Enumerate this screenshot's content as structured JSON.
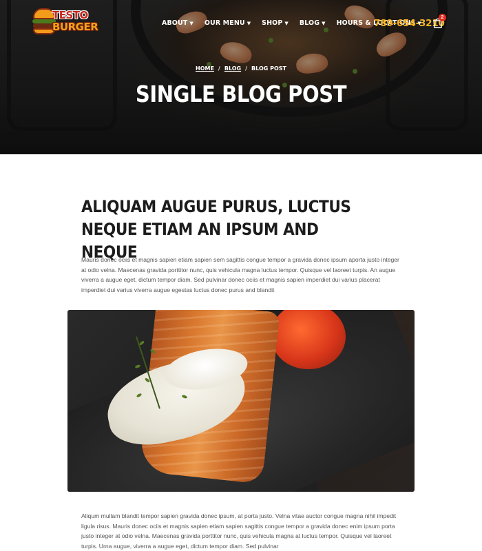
{
  "brand": {
    "line1": "TESTO",
    "line2": "BURGER"
  },
  "nav": [
    {
      "label": "ABOUT"
    },
    {
      "label": "OUR MENU"
    },
    {
      "label": "SHOP"
    },
    {
      "label": "BLOG"
    },
    {
      "label": "HOURS & LOCATIONS"
    }
  ],
  "phone": "789-654-3210",
  "cart": {
    "count": "2"
  },
  "breadcrumb": {
    "home": "HOME",
    "blog": "BLOG",
    "current": "BLOG POST",
    "separator": "/"
  },
  "hero": {
    "title": "SINGLE BLOG POST"
  },
  "post": {
    "title": "ALIQUAM AUGUE PURUS, LUCTUS NEQUE ETIAM AN IPSUM AND NEQUE",
    "paragraph1": "Mauris donec ociis et magnis sapien etiam sapien sem sagittis congue tempor a gravida donec ipsum aporta justo integer at odio velna. Maecenas gravida porttitor nunc, quis vehicula magna luctus tempor. Quisque vel laoreet turpis. An augue viverra a augue eget, dictum tempor diam. Sed pulvinar donec ociis et magnis sapien imperdiet dui varius placerat imperdiet dui varius viverra augue egestas luctus donec purus and blandit",
    "paragraph2": "Aliqum mullam blandit tempor sapien gravida donec ipsum, at porta justo. Velna vitae auctor congue magna nihil impedit ligula risus. Mauris donec ociis et magnis sapien etiam sapien sagittis congue tempor a gravida donec enim ipsum porta justo integer at odio velna. Maecenas gravida porttitor nunc, quis vehicula magna at luctus tempor. Quisque vel laoreet turpis. Urna augue, viverra a augue eget, dictum tempor diam. Sed pulvinar"
  },
  "icons": {
    "nav_chevron": "chevron-down-icon",
    "cart": "shopping-bag-icon"
  },
  "colors": {
    "accent": "#f7b321",
    "badge": "#e32a1c",
    "heading": "#1c1c1c",
    "body_text": "#555555"
  }
}
